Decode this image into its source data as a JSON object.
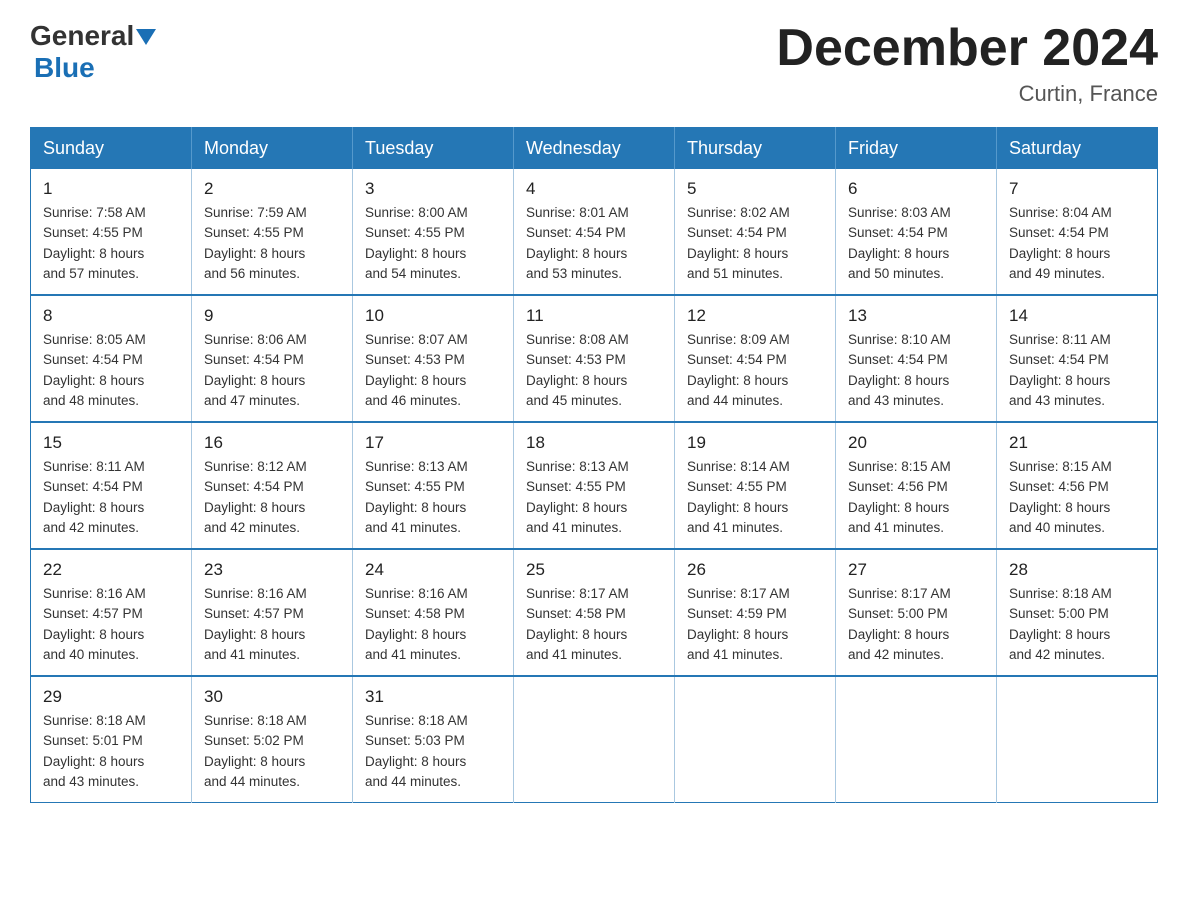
{
  "header": {
    "logo": {
      "text_general": "General",
      "text_blue": "Blue"
    },
    "title": "December 2024",
    "location": "Curtin, France"
  },
  "calendar": {
    "days_of_week": [
      "Sunday",
      "Monday",
      "Tuesday",
      "Wednesday",
      "Thursday",
      "Friday",
      "Saturday"
    ],
    "weeks": [
      [
        {
          "day": "1",
          "sunrise": "7:58 AM",
          "sunset": "4:55 PM",
          "daylight": "8 hours and 57 minutes."
        },
        {
          "day": "2",
          "sunrise": "7:59 AM",
          "sunset": "4:55 PM",
          "daylight": "8 hours and 56 minutes."
        },
        {
          "day": "3",
          "sunrise": "8:00 AM",
          "sunset": "4:55 PM",
          "daylight": "8 hours and 54 minutes."
        },
        {
          "day": "4",
          "sunrise": "8:01 AM",
          "sunset": "4:54 PM",
          "daylight": "8 hours and 53 minutes."
        },
        {
          "day": "5",
          "sunrise": "8:02 AM",
          "sunset": "4:54 PM",
          "daylight": "8 hours and 51 minutes."
        },
        {
          "day": "6",
          "sunrise": "8:03 AM",
          "sunset": "4:54 PM",
          "daylight": "8 hours and 50 minutes."
        },
        {
          "day": "7",
          "sunrise": "8:04 AM",
          "sunset": "4:54 PM",
          "daylight": "8 hours and 49 minutes."
        }
      ],
      [
        {
          "day": "8",
          "sunrise": "8:05 AM",
          "sunset": "4:54 PM",
          "daylight": "8 hours and 48 minutes."
        },
        {
          "day": "9",
          "sunrise": "8:06 AM",
          "sunset": "4:54 PM",
          "daylight": "8 hours and 47 minutes."
        },
        {
          "day": "10",
          "sunrise": "8:07 AM",
          "sunset": "4:53 PM",
          "daylight": "8 hours and 46 minutes."
        },
        {
          "day": "11",
          "sunrise": "8:08 AM",
          "sunset": "4:53 PM",
          "daylight": "8 hours and 45 minutes."
        },
        {
          "day": "12",
          "sunrise": "8:09 AM",
          "sunset": "4:54 PM",
          "daylight": "8 hours and 44 minutes."
        },
        {
          "day": "13",
          "sunrise": "8:10 AM",
          "sunset": "4:54 PM",
          "daylight": "8 hours and 43 minutes."
        },
        {
          "day": "14",
          "sunrise": "8:11 AM",
          "sunset": "4:54 PM",
          "daylight": "8 hours and 43 minutes."
        }
      ],
      [
        {
          "day": "15",
          "sunrise": "8:11 AM",
          "sunset": "4:54 PM",
          "daylight": "8 hours and 42 minutes."
        },
        {
          "day": "16",
          "sunrise": "8:12 AM",
          "sunset": "4:54 PM",
          "daylight": "8 hours and 42 minutes."
        },
        {
          "day": "17",
          "sunrise": "8:13 AM",
          "sunset": "4:55 PM",
          "daylight": "8 hours and 41 minutes."
        },
        {
          "day": "18",
          "sunrise": "8:13 AM",
          "sunset": "4:55 PM",
          "daylight": "8 hours and 41 minutes."
        },
        {
          "day": "19",
          "sunrise": "8:14 AM",
          "sunset": "4:55 PM",
          "daylight": "8 hours and 41 minutes."
        },
        {
          "day": "20",
          "sunrise": "8:15 AM",
          "sunset": "4:56 PM",
          "daylight": "8 hours and 41 minutes."
        },
        {
          "day": "21",
          "sunrise": "8:15 AM",
          "sunset": "4:56 PM",
          "daylight": "8 hours and 40 minutes."
        }
      ],
      [
        {
          "day": "22",
          "sunrise": "8:16 AM",
          "sunset": "4:57 PM",
          "daylight": "8 hours and 40 minutes."
        },
        {
          "day": "23",
          "sunrise": "8:16 AM",
          "sunset": "4:57 PM",
          "daylight": "8 hours and 41 minutes."
        },
        {
          "day": "24",
          "sunrise": "8:16 AM",
          "sunset": "4:58 PM",
          "daylight": "8 hours and 41 minutes."
        },
        {
          "day": "25",
          "sunrise": "8:17 AM",
          "sunset": "4:58 PM",
          "daylight": "8 hours and 41 minutes."
        },
        {
          "day": "26",
          "sunrise": "8:17 AM",
          "sunset": "4:59 PM",
          "daylight": "8 hours and 41 minutes."
        },
        {
          "day": "27",
          "sunrise": "8:17 AM",
          "sunset": "5:00 PM",
          "daylight": "8 hours and 42 minutes."
        },
        {
          "day": "28",
          "sunrise": "8:18 AM",
          "sunset": "5:00 PM",
          "daylight": "8 hours and 42 minutes."
        }
      ],
      [
        {
          "day": "29",
          "sunrise": "8:18 AM",
          "sunset": "5:01 PM",
          "daylight": "8 hours and 43 minutes."
        },
        {
          "day": "30",
          "sunrise": "8:18 AM",
          "sunset": "5:02 PM",
          "daylight": "8 hours and 44 minutes."
        },
        {
          "day": "31",
          "sunrise": "8:18 AM",
          "sunset": "5:03 PM",
          "daylight": "8 hours and 44 minutes."
        },
        null,
        null,
        null,
        null
      ]
    ],
    "labels": {
      "sunrise": "Sunrise:",
      "sunset": "Sunset:",
      "daylight": "Daylight:"
    }
  }
}
